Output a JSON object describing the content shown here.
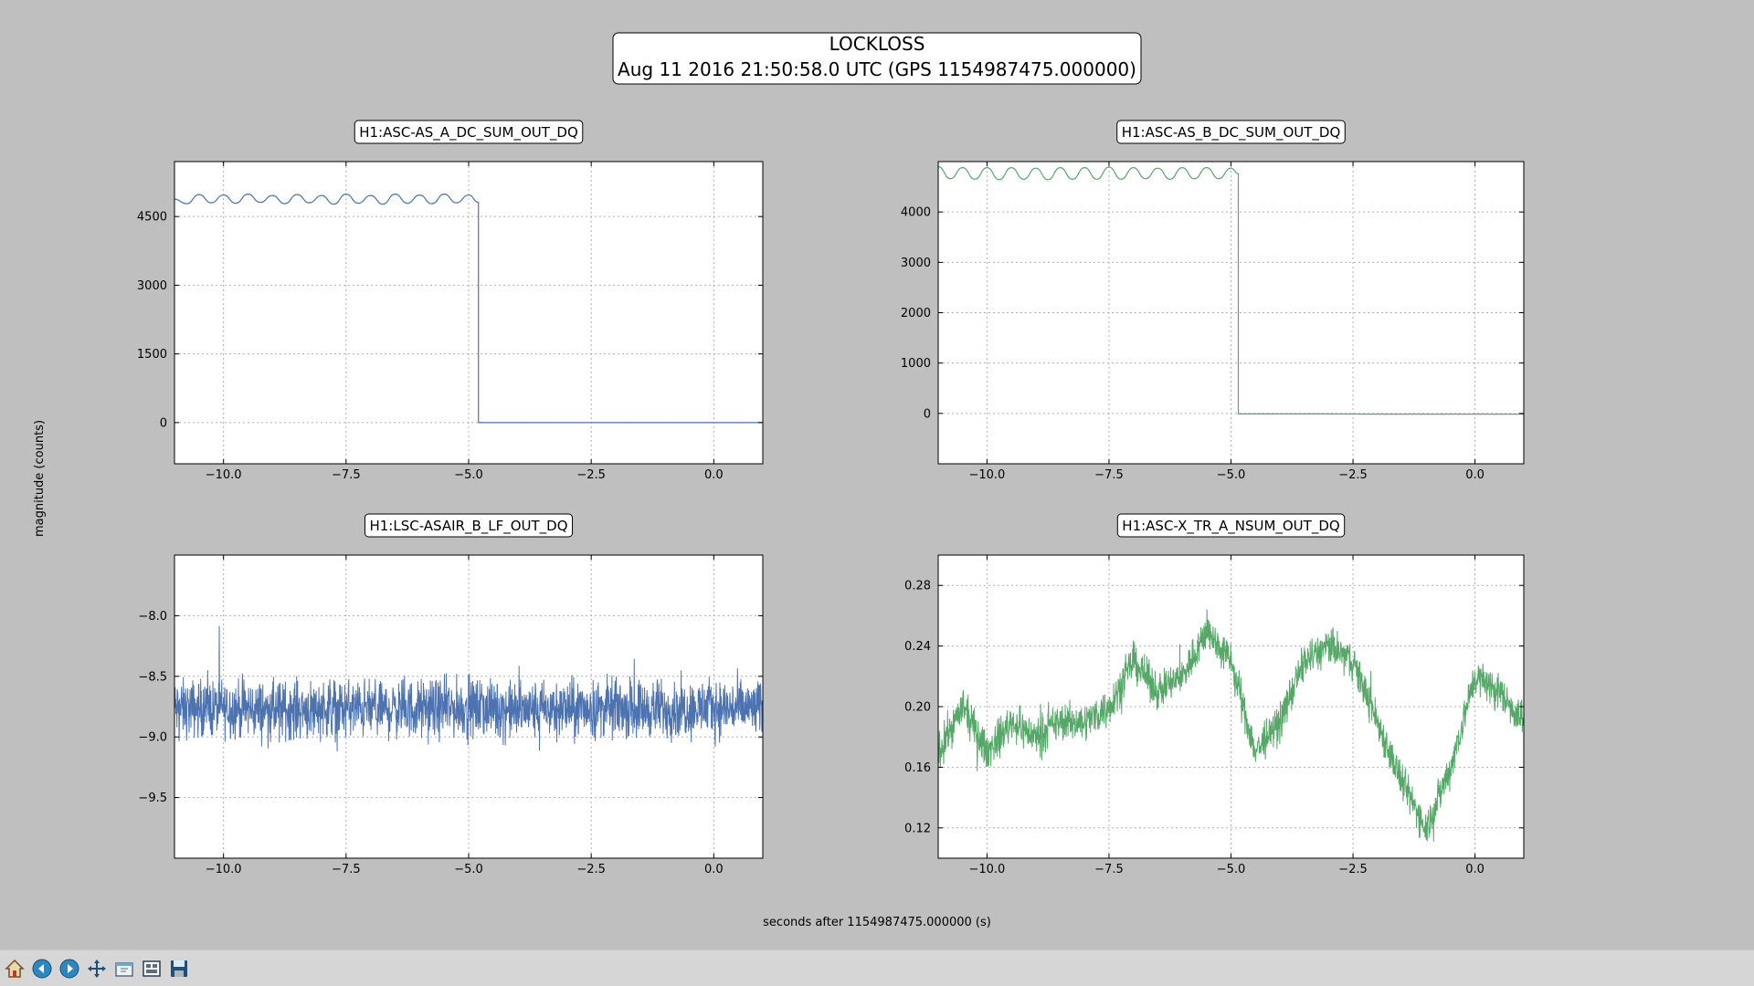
{
  "figure": {
    "title_line1": "LOCKLOSS",
    "title_line2": "Aug 11 2016 21:50:58.0 UTC (GPS 1154987475.000000)",
    "ylabel": "magnitude (counts)",
    "xlabel": "seconds after 1154987475.000000 (s)"
  },
  "colors": {
    "blue": "#4c72b0",
    "green": "#55a868",
    "background": "#bfbfbf",
    "axes_face": "#ffffff"
  },
  "chart_data": [
    {
      "type": "line",
      "title": "H1:ASC-AS_A_DC_SUM_OUT_DQ",
      "color": "#4c72b0",
      "xlim": [
        -11,
        1
      ],
      "ylim": [
        -900,
        5700
      ],
      "xticks": [
        -10.0,
        -7.5,
        -5.0,
        -2.5,
        0.0
      ],
      "xtick_labels": [
        "−10.0",
        "−7.5",
        "−5.0",
        "−2.5",
        "0.0"
      ],
      "yticks": [
        0,
        1500,
        3000,
        4500
      ],
      "ytick_labels": [
        "0",
        "1500",
        "3000",
        "4500"
      ],
      "grid": true,
      "x": [
        -11.0,
        -10.75,
        -10.5,
        -10.25,
        -10.0,
        -9.75,
        -9.5,
        -9.25,
        -9.0,
        -8.75,
        -8.5,
        -8.25,
        -8.0,
        -7.75,
        -7.5,
        -7.25,
        -7.0,
        -6.75,
        -6.5,
        -6.25,
        -6.0,
        -5.75,
        -5.5,
        -5.25,
        -5.0,
        -4.8,
        -4.8,
        -4.6,
        -4.0,
        -3.0,
        -2.0,
        -1.0,
        0.0,
        1.0
      ],
      "y": [
        4880,
        4780,
        4980,
        4800,
        4970,
        4790,
        4990,
        4810,
        4960,
        4780,
        4980,
        4800,
        4960,
        4770,
        4990,
        4790,
        4960,
        4770,
        4990,
        4790,
        4970,
        4780,
        4990,
        4800,
        4970,
        4810,
        0,
        0,
        0,
        0,
        0,
        0,
        0,
        0
      ]
    },
    {
      "type": "line",
      "title": "H1:ASC-AS_B_DC_SUM_OUT_DQ",
      "color": "#55a868",
      "xlim": [
        -11,
        1
      ],
      "ylim": [
        -1000,
        5000
      ],
      "xticks": [
        -10.0,
        -7.5,
        -5.0,
        -2.5,
        0.0
      ],
      "xtick_labels": [
        "−10.0",
        "−7.5",
        "−5.0",
        "−2.5",
        "0.0"
      ],
      "yticks": [
        0,
        1000,
        2000,
        3000,
        4000
      ],
      "ytick_labels": [
        "0",
        "1000",
        "2000",
        "3000",
        "4000"
      ],
      "grid": true,
      "x": [
        -11.0,
        -10.75,
        -10.5,
        -10.25,
        -10.0,
        -9.75,
        -9.5,
        -9.25,
        -9.0,
        -8.75,
        -8.5,
        -8.25,
        -8.0,
        -7.75,
        -7.5,
        -7.25,
        -7.0,
        -6.75,
        -6.5,
        -6.25,
        -6.0,
        -5.75,
        -5.5,
        -5.25,
        -5.0,
        -4.85,
        -4.85,
        -4.6,
        -4.0,
        -3.0,
        -2.0,
        -1.0,
        0.0,
        1.0
      ],
      "y": [
        4900,
        4660,
        4880,
        4650,
        4880,
        4640,
        4880,
        4650,
        4870,
        4640,
        4880,
        4650,
        4880,
        4650,
        4890,
        4650,
        4880,
        4660,
        4870,
        4650,
        4880,
        4660,
        4880,
        4660,
        4870,
        4760,
        -10,
        -10,
        -10,
        -10,
        -15,
        -15,
        -15,
        -15
      ]
    },
    {
      "type": "line",
      "title": "H1:LSC-ASAIR_B_LF_OUT_DQ",
      "color": "#4c72b0",
      "xlim": [
        -11,
        1
      ],
      "ylim": [
        -10.0,
        -7.5
      ],
      "xticks": [
        -10.0,
        -7.5,
        -5.0,
        -2.5,
        0.0
      ],
      "xtick_labels": [
        "−10.0",
        "−7.5",
        "−5.0",
        "−2.5",
        "0.0"
      ],
      "yticks": [
        -9.5,
        -9.0,
        -8.5,
        -8.0
      ],
      "ytick_labels": [
        "−9.5",
        "−9.0",
        "−8.5",
        "−8.0"
      ],
      "grid": true,
      "x": [
        -11.0,
        -10.0,
        -9.0,
        -8.0,
        -7.0,
        -6.0,
        -5.0,
        -4.0,
        -3.0,
        -2.0,
        -1.0,
        0.0,
        1.0
      ],
      "y": [
        -8.77,
        -8.76,
        -8.78,
        -8.76,
        -8.77,
        -8.77,
        -8.76,
        -8.78,
        -8.77,
        -8.76,
        -8.77,
        -8.76,
        -8.77
      ],
      "band_halfwidth": 0.35
    },
    {
      "type": "line",
      "title": "H1:ASC-X_TR_A_NSUM_OUT_DQ",
      "color": "#55a868",
      "xlim": [
        -11,
        1
      ],
      "ylim": [
        0.1,
        0.3
      ],
      "xticks": [
        -10.0,
        -7.5,
        -5.0,
        -2.5,
        0.0
      ],
      "xtick_labels": [
        "−10.0",
        "−7.5",
        "−5.0",
        "−2.5",
        "0.0"
      ],
      "yticks": [
        0.12,
        0.16,
        0.2,
        0.24,
        0.28
      ],
      "ytick_labels": [
        "0.12",
        "0.16",
        "0.20",
        "0.24",
        "0.28"
      ],
      "grid": true,
      "x": [
        -11.0,
        -10.5,
        -10.0,
        -9.5,
        -9.0,
        -8.5,
        -8.0,
        -7.5,
        -7.0,
        -6.5,
        -6.0,
        -5.5,
        -5.0,
        -4.5,
        -4.0,
        -3.5,
        -3.0,
        -2.5,
        -2.0,
        -1.5,
        -1.0,
        -0.5,
        0.0,
        0.5,
        1.0
      ],
      "y": [
        0.17,
        0.2,
        0.17,
        0.19,
        0.18,
        0.19,
        0.19,
        0.2,
        0.23,
        0.21,
        0.22,
        0.25,
        0.23,
        0.17,
        0.19,
        0.23,
        0.24,
        0.23,
        0.19,
        0.15,
        0.12,
        0.16,
        0.22,
        0.21,
        0.19
      ],
      "band_halfwidth": 0.018
    }
  ],
  "toolbar": {
    "buttons": [
      {
        "name": "home-button",
        "icon": "home-icon"
      },
      {
        "name": "back-button",
        "icon": "back-arrow-icon"
      },
      {
        "name": "forward-button",
        "icon": "forward-arrow-icon"
      },
      {
        "name": "pan-button",
        "icon": "pan-icon"
      },
      {
        "name": "zoom-button",
        "icon": "zoom-rect-icon"
      },
      {
        "name": "subplots-button",
        "icon": "subplots-icon"
      },
      {
        "name": "save-button",
        "icon": "save-icon"
      }
    ]
  }
}
